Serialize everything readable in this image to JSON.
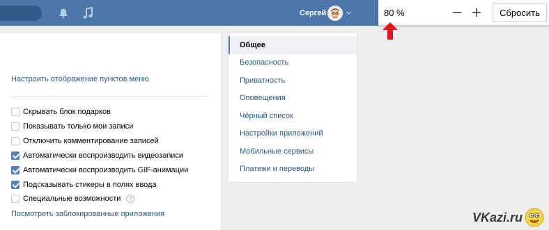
{
  "topbar": {
    "username": "Сергей",
    "icons": [
      "bell-icon",
      "music-icon",
      "chevron-down-icon"
    ]
  },
  "zoom": {
    "value": "80 %",
    "reset_label": "Сбросить"
  },
  "settings": {
    "menu_link": "Настроить отображение пунктов меню",
    "options": [
      {
        "label": "Скрывать блок подарков",
        "checked": false
      },
      {
        "label": "Показывать только мои записи",
        "checked": false
      },
      {
        "label": "Отключить комментирование записей",
        "checked": false
      },
      {
        "label": "Автоматически воспроизводить видеозаписи",
        "checked": true
      },
      {
        "label": "Автоматически воспроизводить GIF-анимации",
        "checked": true
      },
      {
        "label": "Подсказывать стикеры в полях ввода",
        "checked": true
      },
      {
        "label": "Специальные возможности",
        "checked": false,
        "help": "?"
      }
    ],
    "blocked_apps_link": "Посмотреть заблокированные приложения"
  },
  "side_menu": {
    "items": [
      {
        "label": "Общее",
        "active": true
      },
      {
        "label": "Безопасность"
      },
      {
        "label": "Приватность"
      },
      {
        "label": "Оповещения"
      },
      {
        "label": "Чёрный список"
      },
      {
        "label": "Настройки приложений"
      },
      {
        "label": "Мобильные сервисы"
      },
      {
        "label": "Платежи и переводы"
      }
    ]
  },
  "watermark": "VKazi.ru",
  "colors": {
    "header": "#4a76a8",
    "link": "#2a5885",
    "accent": "#5181b8",
    "arrow": "#e8141a"
  }
}
